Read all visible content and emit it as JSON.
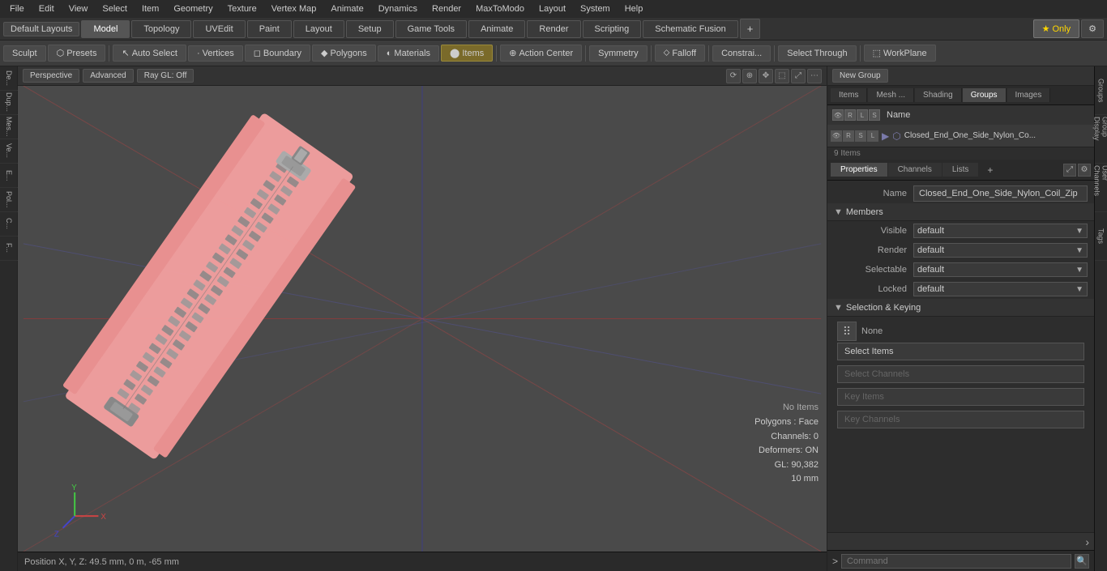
{
  "menubar": {
    "items": [
      "File",
      "Edit",
      "View",
      "Select",
      "Item",
      "Geometry",
      "Texture",
      "Vertex Map",
      "Animate",
      "Dynamics",
      "Render",
      "MaxToModo",
      "Layout",
      "System",
      "Help"
    ]
  },
  "layoutbar": {
    "layout_dropdown": "Default Layouts",
    "tabs": [
      "Model",
      "Topology",
      "UVEdit",
      "Paint",
      "Layout",
      "Setup",
      "Game Tools",
      "Animate",
      "Render",
      "Scripting",
      "Schematic Fusion"
    ],
    "only_label": "★ Only",
    "plus_icon": "+"
  },
  "toolbar": {
    "sculpt": "Sculpt",
    "presets": "Presets",
    "auto_select": "Auto Select",
    "vertices": "Vertices",
    "boundary": "Boundary",
    "polygons": "Polygons",
    "materials": "Materials",
    "items": "Items",
    "action_center": "Action Center",
    "symmetry": "Symmetry",
    "falloff": "Falloff",
    "constraints": "Constrai...",
    "select_through": "Select Through",
    "workplane": "WorkPlane"
  },
  "viewport": {
    "mode": "Perspective",
    "render_mode": "Advanced",
    "gl_mode": "Ray GL: Off",
    "info": {
      "no_items": "No Items",
      "polygons": "Polygons : Face",
      "channels": "Channels: 0",
      "deformers": "Deformers: ON",
      "gl": "GL: 90,382",
      "scale": "10 mm"
    }
  },
  "statusbar": {
    "position": "Position X, Y, Z:  49.5 mm, 0 m, -65 mm"
  },
  "groups_panel": {
    "new_group_label": "New Group",
    "tabs": [
      "Items",
      "Mesh ...",
      "Shading",
      "Groups",
      "Images"
    ],
    "active_tab": "Groups",
    "header": {
      "name_col": "Name"
    },
    "items": [
      {
        "name": "Closed_End_One_Side_Nylon_Co...",
        "count": "9 Items"
      }
    ]
  },
  "properties": {
    "tabs": [
      "Properties",
      "Channels",
      "Lists"
    ],
    "active_tab": "Properties",
    "name_value": "Closed_End_One_Side_Nylon_Coil_Zip",
    "sections": {
      "members": {
        "label": "Members",
        "visible": "default",
        "render": "default",
        "selectable": "default",
        "locked": "default"
      },
      "selection_keying": {
        "label": "Selection & Keying",
        "none_label": "None",
        "buttons": [
          {
            "label": "Select Items",
            "disabled": false
          },
          {
            "label": "Select Channels",
            "disabled": true
          },
          {
            "label": "Key Items",
            "disabled": true
          },
          {
            "label": "Key Channels",
            "disabled": true
          }
        ]
      }
    }
  },
  "command_bar": {
    "prompt": ">",
    "placeholder": "Command"
  },
  "right_vtabs": [
    "Groups",
    "Group Display",
    "User Channels",
    "Tags"
  ]
}
